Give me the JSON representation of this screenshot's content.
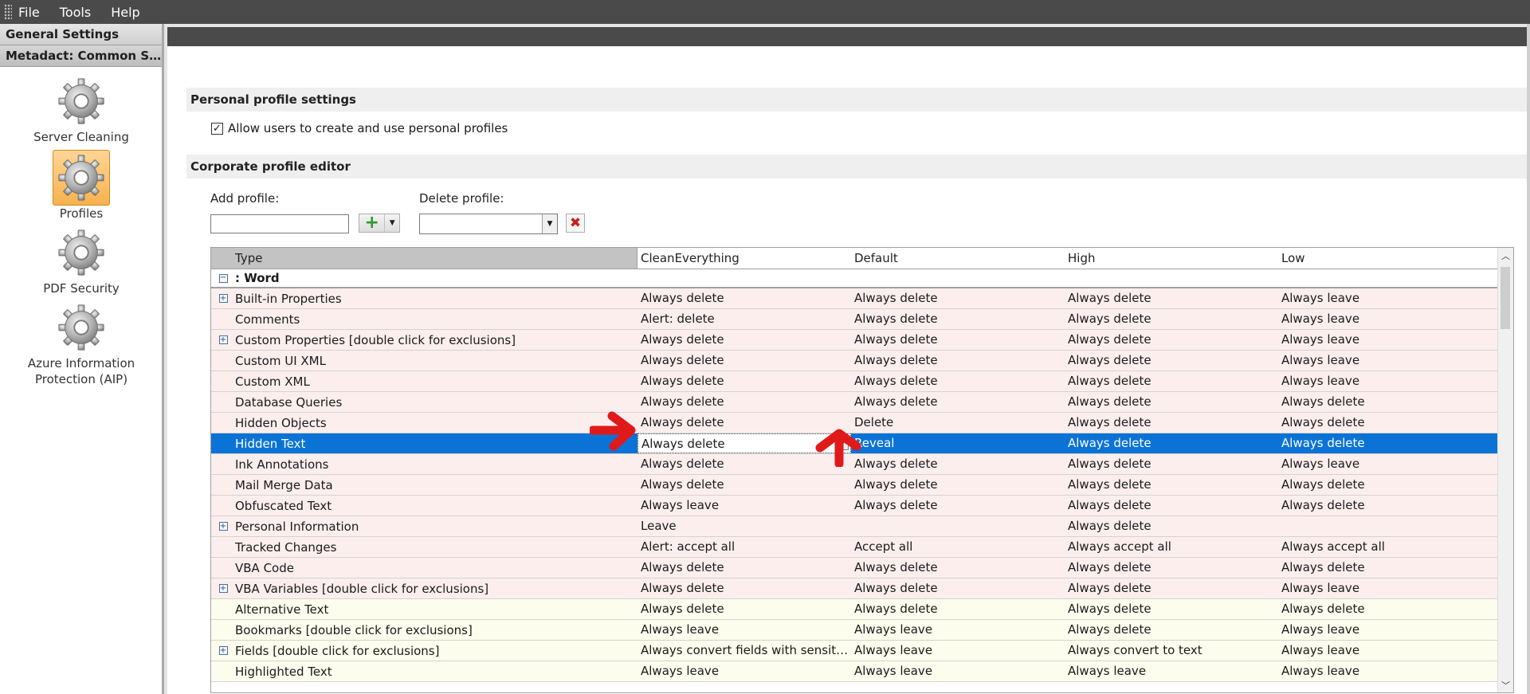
{
  "menu": {
    "items": [
      "File",
      "Tools",
      "Help"
    ]
  },
  "nav": {
    "headers": [
      "General Settings",
      "Metadact: Common Setti..."
    ],
    "items": [
      {
        "label": "Server Cleaning"
      },
      {
        "label": "Profiles",
        "selected": true
      },
      {
        "label": "PDF Security"
      },
      {
        "label": "Azure Information Protection (AIP)"
      }
    ]
  },
  "personal": {
    "section_title": "Personal profile settings",
    "checkbox_label": "Allow users to create and use personal profiles",
    "checked": true
  },
  "corporate": {
    "section_title": "Corporate profile editor",
    "add_label": "Add profile:",
    "delete_label": "Delete profile:",
    "add_value": "",
    "delete_value": ""
  },
  "grid": {
    "columns": [
      "Type",
      "CleanEverything",
      "Default",
      "High",
      "Low"
    ],
    "group": ": Word",
    "rows": [
      {
        "type": "Built-in Properties",
        "expandable": true,
        "values": [
          "Always delete",
          "Always delete",
          "Always delete",
          "Always leave"
        ],
        "tone": "pink"
      },
      {
        "type": "Comments",
        "expandable": false,
        "values": [
          "Alert: delete",
          "Always delete",
          "Always delete",
          "Always leave"
        ],
        "tone": "pink"
      },
      {
        "type": "Custom Properties [double click for exclusions]",
        "expandable": true,
        "values": [
          "Always delete",
          "Always delete",
          "Always delete",
          "Always leave"
        ],
        "tone": "pink"
      },
      {
        "type": "Custom UI XML",
        "expandable": false,
        "values": [
          "Always delete",
          "Always delete",
          "Always delete",
          "Always leave"
        ],
        "tone": "pink"
      },
      {
        "type": "Custom XML",
        "expandable": false,
        "values": [
          "Always delete",
          "Always delete",
          "Always delete",
          "Always leave"
        ],
        "tone": "pink"
      },
      {
        "type": "Database Queries",
        "expandable": false,
        "values": [
          "Always delete",
          "Always delete",
          "Always delete",
          "Always delete"
        ],
        "tone": "pink"
      },
      {
        "type": "Hidden Objects",
        "expandable": false,
        "values": [
          "Always delete",
          "Delete",
          "Always delete",
          "Always delete"
        ],
        "tone": "pink"
      },
      {
        "type": "Hidden Text",
        "expandable": false,
        "values": [
          "Always delete",
          "Reveal",
          "Always delete",
          "Always delete"
        ],
        "tone": "selected",
        "editing_col": 0
      },
      {
        "type": "Ink Annotations",
        "expandable": false,
        "values": [
          "Always delete",
          "Always delete",
          "Always delete",
          "Always leave"
        ],
        "tone": "pink"
      },
      {
        "type": "Mail Merge Data",
        "expandable": false,
        "values": [
          "Always delete",
          "Always delete",
          "Always delete",
          "Always delete"
        ],
        "tone": "pink"
      },
      {
        "type": "Obfuscated Text",
        "expandable": false,
        "values": [
          "Always leave",
          "Always delete",
          "Always delete",
          "Always delete"
        ],
        "tone": "pink"
      },
      {
        "type": "Personal Information",
        "expandable": true,
        "values": [
          "Leave",
          "",
          "Always delete",
          ""
        ],
        "tone": "pink"
      },
      {
        "type": "Tracked Changes",
        "expandable": false,
        "values": [
          "Alert: accept all",
          "Accept all",
          "Always accept all",
          "Always accept all"
        ],
        "tone": "pink"
      },
      {
        "type": "VBA Code",
        "expandable": false,
        "values": [
          "Always delete",
          "Always delete",
          "Always delete",
          "Always delete"
        ],
        "tone": "pink"
      },
      {
        "type": "VBA Variables [double click for exclusions]",
        "expandable": true,
        "values": [
          "Always delete",
          "Always delete",
          "Always delete",
          "Always leave"
        ],
        "tone": "pink"
      },
      {
        "type": "Alternative Text",
        "expandable": false,
        "values": [
          "Always delete",
          "Always delete",
          "Always delete",
          "Always delete"
        ],
        "tone": "cream"
      },
      {
        "type": "Bookmarks [double click for exclusions]",
        "expandable": false,
        "values": [
          "Always leave",
          "Always leave",
          "Always delete",
          "Always leave"
        ],
        "tone": "cream"
      },
      {
        "type": "Fields [double click for exclusions]",
        "expandable": true,
        "values": [
          "Always convert fields with sensitive lin...",
          "Always leave",
          "Always convert to text",
          "Always leave"
        ],
        "tone": "cream"
      },
      {
        "type": "Highlighted Text",
        "expandable": false,
        "values": [
          "Always leave",
          "Always leave",
          "Always leave",
          "Always leave"
        ],
        "tone": "cream"
      }
    ]
  },
  "colors": {
    "selection": "#0b73d6",
    "row_pink": "#fdeeee",
    "row_cream": "#fdfdee",
    "annotation_arrow": "#e01a1a",
    "menubar": "#4a4a4a"
  }
}
